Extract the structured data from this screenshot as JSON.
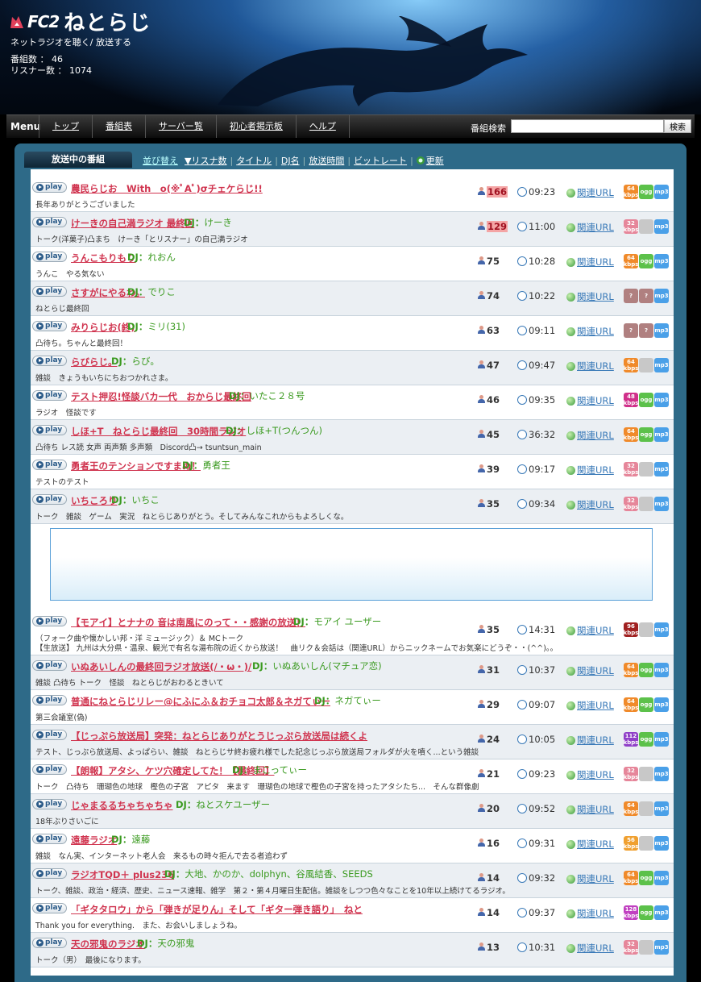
{
  "header": {
    "logo_fc2": "FC2",
    "logo_name": "ねとらじ",
    "tagline": "ネットラジオを聴く/ 放送する",
    "programs_label": "番組数 ： 46",
    "listeners_label": "リスナー数 ： 1074"
  },
  "nav": {
    "menu_label": "Menu",
    "items": [
      "トップ",
      "番組表",
      "サーバー覧",
      "初心者掲示板",
      "ヘルプ"
    ],
    "search_label": "番組検索",
    "search_value": "",
    "search_button": "検索"
  },
  "tabs": {
    "current": "放送中の番組",
    "sort_label": "並び替え",
    "sorts": [
      "▼リスナ数",
      "タイトル",
      "DJ名",
      "放送時間",
      "ビットレート"
    ],
    "refresh": "更新"
  },
  "colors": {
    "title": "#d0344f",
    "dj": "#3a9a1f",
    "link": "#3a7ab8",
    "frame": "#2e6a88"
  },
  "play_label": "play",
  "url_label": "関連URL",
  "programs": [
    {
      "title": "農民らじお　With　o(※ﾟAﾟ)σチェケらじ!!",
      "dj": "",
      "desc": "長年ありがとうございました",
      "listeners": "166",
      "hot": true,
      "time": "09:23",
      "badges": [
        [
          "64",
          "kbps",
          "#f08a2a"
        ],
        [
          "ogg",
          "",
          "#5cc14a"
        ],
        [
          "mp3",
          "",
          "#4aa0e8"
        ]
      ]
    },
    {
      "title": "けーきの自己満ラジオ 最終回",
      "dj": "けーき",
      "desc": "トーク(洋菓子)凸まち　けーき「とリスナー」の自己満ラジオ",
      "listeners": "129",
      "hot": true,
      "time": "11:00",
      "badges": [
        [
          "32",
          "kbps",
          "#e6869a"
        ],
        [
          "",
          "",
          "#c8c8c8"
        ],
        [
          "mp3",
          "",
          "#4aa0e8"
        ]
      ]
    },
    {
      "title": "うんこもりもり",
      "dj": "れおん",
      "desc": "うんこ　やる気ない",
      "listeners": "75",
      "hot": false,
      "time": "10:28",
      "badges": [
        [
          "64",
          "kbps",
          "#f08a2a"
        ],
        [
          "ogg",
          "",
          "#5cc14a"
        ],
        [
          "mp3",
          "",
          "#4aa0e8"
        ]
      ]
    },
    {
      "title": "さすがにやるわ。",
      "dj": "でりこ",
      "desc": "ねとらじ最終回",
      "listeners": "74",
      "hot": false,
      "time": "10:22",
      "badges": [
        [
          "?",
          "",
          "#b08080"
        ],
        [
          "?",
          "",
          "#b08080"
        ],
        [
          "mp3",
          "",
          "#4aa0e8"
        ]
      ]
    },
    {
      "title": "みりらじお(終)",
      "dj": "ミリ(31)",
      "desc": "凸待ち。ちゃんと最終回！",
      "listeners": "63",
      "hot": false,
      "time": "09:11",
      "badges": [
        [
          "?",
          "",
          "#b08080"
        ],
        [
          "?",
          "",
          "#b08080"
        ],
        [
          "mp3",
          "",
          "#4aa0e8"
        ]
      ]
    },
    {
      "title": "らびらじ。",
      "dj": "らび。",
      "desc": "雑談　きょうもいちにちおつかれさま。",
      "listeners": "47",
      "hot": false,
      "time": "09:47",
      "badges": [
        [
          "64",
          "kbps",
          "#f08a2a"
        ],
        [
          "",
          "",
          "#c8c8c8"
        ],
        [
          "mp3",
          "",
          "#4aa0e8"
        ]
      ]
    },
    {
      "title": "テスト押忍!怪談バカ一代　おからじ最終回",
      "dj": "いたこ２８号",
      "desc": "ラジオ　怪談です",
      "listeners": "46",
      "hot": false,
      "time": "09:35",
      "badges": [
        [
          "48",
          "kbps",
          "#d0308a"
        ],
        [
          "ogg",
          "",
          "#5cc14a"
        ],
        [
          "mp3",
          "",
          "#4aa0e8"
        ]
      ]
    },
    {
      "title": "しほ+T　ねとらじ最終回　30時間ラジオ",
      "dj": "しほ+T(つんつん)",
      "desc": "凸待ち レス読 女声 両声類 多声類　Discord凸→ tsuntsun_main",
      "listeners": "45",
      "hot": false,
      "time": "36:32",
      "badges": [
        [
          "64",
          "kbps",
          "#f08a2a"
        ],
        [
          "ogg",
          "",
          "#5cc14a"
        ],
        [
          "mp3",
          "",
          "#4aa0e8"
        ]
      ]
    },
    {
      "title": "勇者王のテンションですまぬ！",
      "dj": "勇者王",
      "desc": "テストのテスト",
      "listeners": "39",
      "hot": false,
      "time": "09:17",
      "badges": [
        [
          "32",
          "kbps",
          "#e6869a"
        ],
        [
          "",
          "",
          "#c8c8c8"
        ],
        [
          "mp3",
          "",
          "#4aa0e8"
        ]
      ]
    },
    {
      "title": "いちころり",
      "dj": "いちこ",
      "desc": "トーク　雑談　ゲーム　実況　ねとらじありがとう。そしてみんなこれからもよろしくな。",
      "listeners": "35",
      "hot": false,
      "time": "09:34",
      "badges": [
        [
          "32",
          "kbps",
          "#e6869a"
        ],
        [
          "",
          "",
          "#c8c8c8"
        ],
        [
          "mp3",
          "",
          "#4aa0e8"
        ]
      ]
    },
    {
      "title": "【モアイ】とナナの 音は南風にのって・・感謝の放送！",
      "dj": "モアイ ユーザー",
      "desc": "（フォーク曲や懐かしい邦・洋 ミュージック）＆ MCトーク",
      "desc2": "【生放送】 九州は大分県・温泉、観光で有名な湯布院の近くから放送！　曲リク＆会話は（関連URL）からニックネームでお気楽にどうぞ・・(^^)。。",
      "listeners": "35",
      "hot": false,
      "time": "14:31",
      "badges": [
        [
          "96",
          "kbps",
          "#a02020"
        ],
        [
          "",
          "",
          "#c8c8c8"
        ],
        [
          "mp3",
          "",
          "#4aa0e8"
        ]
      ]
    },
    {
      "title": "いぬあいしんの最終回ラジオ放送(/・ω・)/",
      "dj": "いぬあいしん(マチュア恋)",
      "desc": "雑談 凸待ち トーク　怪談　ねとらじがおわるときいて",
      "listeners": "31",
      "hot": false,
      "time": "10:37",
      "badges": [
        [
          "64",
          "kbps",
          "#f08a2a"
        ],
        [
          "ogg",
          "",
          "#5cc14a"
        ],
        [
          "mp3",
          "",
          "#4aa0e8"
        ]
      ]
    },
    {
      "title": "普通にねとらじリレー@にふにふ＆おチョコ太郎＆ネガてぃー",
      "dj": "ネガてぃー",
      "desc": "第三会議室(偽)",
      "listeners": "29",
      "hot": false,
      "time": "09:07",
      "badges": [
        [
          "64",
          "kbps",
          "#f08a2a"
        ],
        [
          "ogg",
          "",
          "#5cc14a"
        ],
        [
          "mp3",
          "",
          "#4aa0e8"
        ]
      ]
    },
    {
      "title": "【じっぷら放送局】突発：ねとらじありがとうじっぷら放送局は続くよ",
      "dj": "",
      "desc": "テスト、じっぷら放送局、よっぱらい、雑談　ねとらじサ終お疲れ様でした記念じっぷら放送局フォルダが火を噴く...という雑談",
      "listeners": "24",
      "hot": false,
      "time": "10:05",
      "badges": [
        [
          "112",
          "kbps",
          "#9040c8"
        ],
        [
          "ogg",
          "",
          "#5cc14a"
        ],
        [
          "mp3",
          "",
          "#4aa0e8"
        ]
      ]
    },
    {
      "title": "【朗報】アタシ、ケツ穴確定してた！【最終回】",
      "dj": "まこってぃー",
      "desc": "トーク　凸待ち　珊瑚色の地球　樫色の子宮　アピタ　来ます　珊瑚色の地球で樫色の子宮を持ったアタシたち...　そんな群像劇",
      "listeners": "21",
      "hot": false,
      "time": "09:23",
      "badges": [
        [
          "32",
          "kbps",
          "#e6869a"
        ],
        [
          "",
          "",
          "#c8c8c8"
        ],
        [
          "mp3",
          "",
          "#4aa0e8"
        ]
      ]
    },
    {
      "title": "じゃまるるちゃちゃちゃ",
      "dj": "ねとスケユーザー",
      "desc": "18年ぶりさいごに",
      "listeners": "20",
      "hot": false,
      "time": "09:52",
      "badges": [
        [
          "64",
          "kbps",
          "#f08a2a"
        ],
        [
          "",
          "",
          "#c8c8c8"
        ],
        [
          "mp3",
          "",
          "#4aa0e8"
        ]
      ]
    },
    {
      "title": "遠藤ラジオ",
      "dj": "遠藤",
      "desc": "雑談　なん実、インターネット老人会　来るもの時々拒んで去る者追わず",
      "listeners": "16",
      "hot": false,
      "time": "09:31",
      "badges": [
        [
          "56",
          "kbps",
          "#f0a030"
        ],
        [
          "",
          "",
          "#c8c8c8"
        ],
        [
          "mp3",
          "",
          "#4aa0e8"
        ]
      ]
    },
    {
      "title": "ラジオTQD＋ plus236",
      "dj": "大地、かのか、dolphyn、谷風結香、SEEDS",
      "desc": "トーク、雑談、政治・経済、歴史、ニュース速報、雑学　第２・第４月曜日生配信。雑談をしつつ色々なことを10年以上続けてるラジオ。",
      "listeners": "14",
      "hot": false,
      "time": "09:32",
      "badges": [
        [
          "64",
          "kbps",
          "#f08a2a"
        ],
        [
          "ogg",
          "",
          "#5cc14a"
        ],
        [
          "mp3",
          "",
          "#4aa0e8"
        ]
      ]
    },
    {
      "title": "「ギタタロウ」から「弾きが足りん」そして「ギター弾き語り」　ねと",
      "dj": "",
      "desc": "Thank you for everything.　また、お会いしましょうね。",
      "listeners": "14",
      "hot": false,
      "time": "09:37",
      "badges": [
        [
          "128",
          "kbps",
          "#c040c0"
        ],
        [
          "ogg",
          "",
          "#5cc14a"
        ],
        [
          "mp3",
          "",
          "#4aa0e8"
        ]
      ]
    },
    {
      "title": "天の邪鬼のラジオ",
      "dj": "天の邪鬼",
      "desc": "トーク（男）　最後になります。",
      "listeners": "13",
      "hot": false,
      "time": "10:31",
      "badges": [
        [
          "32",
          "kbps",
          "#e6869a"
        ],
        [
          "",
          "",
          "#c8c8c8"
        ],
        [
          "mp3",
          "",
          "#4aa0e8"
        ]
      ]
    }
  ]
}
